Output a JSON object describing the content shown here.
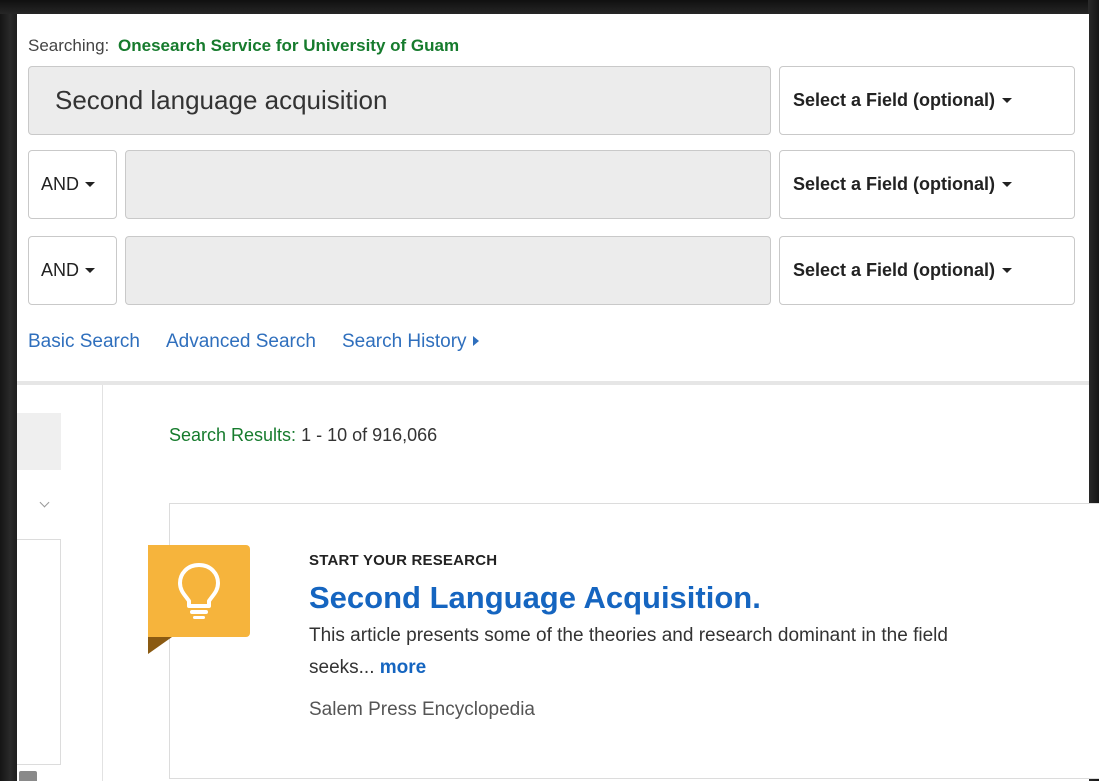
{
  "search": {
    "searching_label": "Searching:",
    "database": "Onesearch Service for University of Guam",
    "rows": [
      {
        "value": "Second language acquisition",
        "field": "Select a Field (optional)"
      },
      {
        "operator": "AND",
        "value": "",
        "field": "Select a Field (optional)"
      },
      {
        "operator": "AND",
        "value": "",
        "field": "Select a Field (optional)"
      }
    ],
    "links": {
      "basic": "Basic Search",
      "advanced": "Advanced Search",
      "history": "Search History"
    }
  },
  "results": {
    "label": "Search Results:",
    "range": "1 - 10 of 916,066"
  },
  "placard": {
    "kicker": "START YOUR RESEARCH",
    "title": "Second Language Acquisition.",
    "abstract_line1": "This article presents some of the theories and research dominant in the field",
    "abstract_line2": "seeks...",
    "more_link": "more",
    "source": "Salem Press Encyclopedia",
    "badge_color": "#f6b43c",
    "icon": "lightbulb-icon"
  },
  "colors": {
    "accent_green": "#167b2d",
    "link_blue": "#2f6fbd",
    "title_blue": "#1565c0"
  }
}
